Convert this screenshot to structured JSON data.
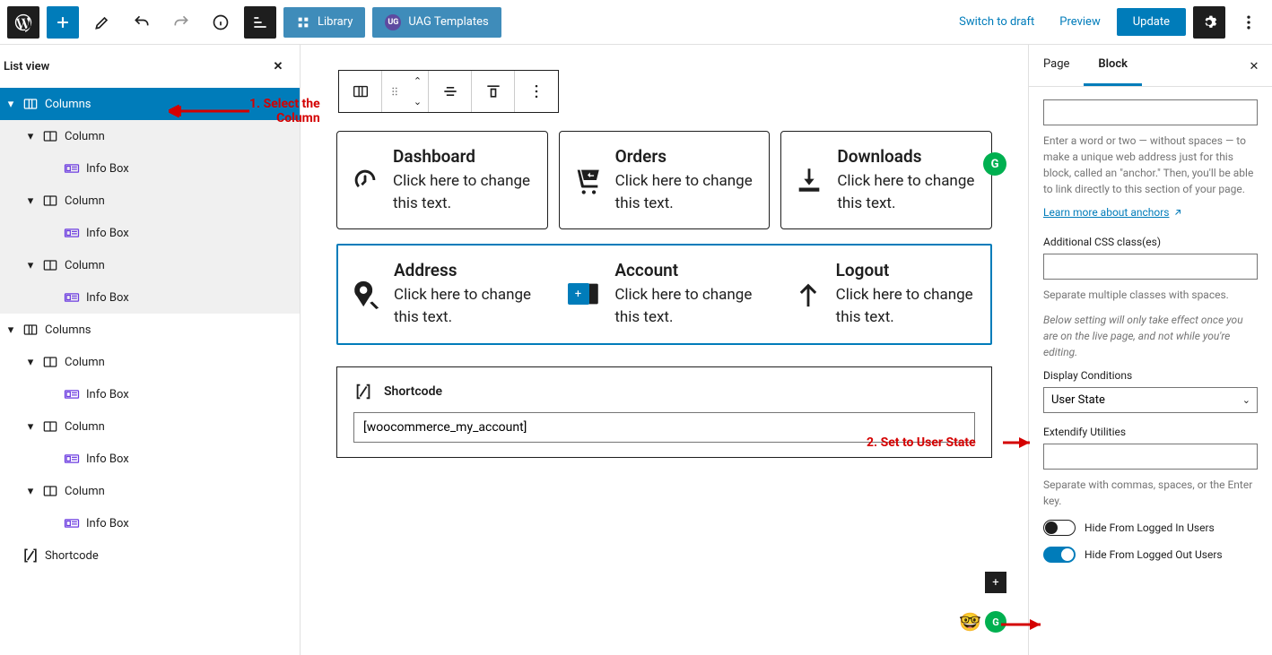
{
  "topbar": {
    "library": "Library",
    "uag": "UAG Templates",
    "switch_draft": "Switch to draft",
    "preview": "Preview",
    "update": "Update"
  },
  "listview": {
    "title": "List view",
    "columns": "Columns",
    "column": "Column",
    "infobox": "Info Box",
    "shortcode": "Shortcode"
  },
  "cards": {
    "dashboard": "Dashboard",
    "orders": "Orders",
    "downloads": "Downloads",
    "address": "Address",
    "account": "Account",
    "logout": "Logout",
    "placeholder": "Click here to change this text."
  },
  "shortcode": {
    "label": "Shortcode",
    "value": "[woocommerce_my_account]"
  },
  "sidebar": {
    "page_tab": "Page",
    "block_tab": "Block",
    "anchor_help": "Enter a word or two — without spaces — to make a unique web address just for this block, called an \"anchor.\" Then, you'll be able to link directly to this section of your page.",
    "anchor_link": "Learn more about anchors",
    "css_label": "Additional CSS class(es)",
    "css_help": "Separate multiple classes with spaces.",
    "live_note": "Below setting will only take effect once you are on the live page, and not while you're editing.",
    "dc_label": "Display Conditions",
    "dc_value": "User State",
    "ext_label": "Extendify Utilities",
    "ext_help": "Separate with commas, spaces, or the Enter key.",
    "hide_in": "Hide From Logged In Users",
    "hide_out": "Hide From Logged Out Users"
  },
  "annotations": {
    "a1_line1": "1. Select the",
    "a1_line2": "Column",
    "a2": "2. Set to User State"
  }
}
